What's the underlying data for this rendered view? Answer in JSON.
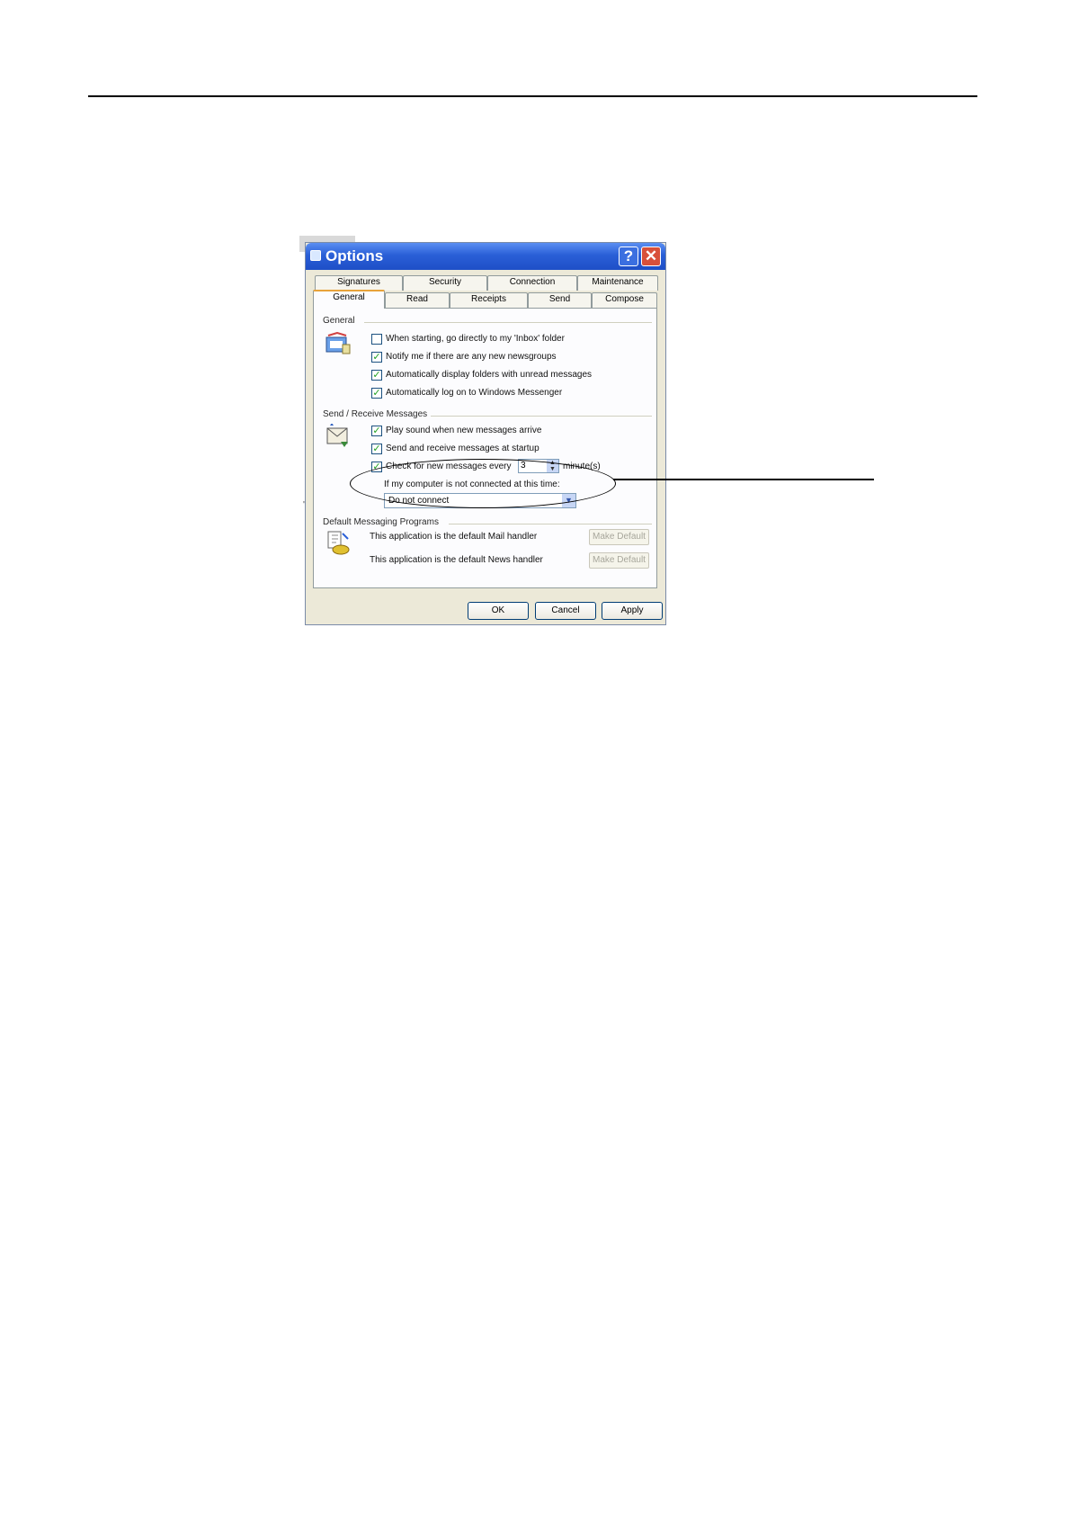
{
  "dialog": {
    "title": "Options",
    "help_label": "?",
    "close_label": "✕",
    "tabs_back": [
      "Signatures",
      "Security",
      "Connection",
      "Maintenance"
    ],
    "tabs_front": [
      "General",
      "Read",
      "Receipts",
      "Send",
      "Compose"
    ],
    "active_tab": "General"
  },
  "general": {
    "label": "General",
    "options": [
      {
        "label": "When starting, go directly to my 'Inbox' folder",
        "checked": false
      },
      {
        "label": "Notify me if there are any new newsgroups",
        "checked": true
      },
      {
        "label": "Automatically display folders with unread messages",
        "checked": true
      },
      {
        "label": "Automatically log on to Windows Messenger",
        "checked": true
      }
    ]
  },
  "send_receive": {
    "label": "Send / Receive Messages",
    "options": [
      {
        "label": "Play sound when new messages arrive",
        "checked": true
      },
      {
        "label": "Send and receive messages at startup",
        "checked": true
      },
      {
        "label": "Check for new messages every",
        "checked": true
      }
    ],
    "interval_value": "3",
    "interval_unit": "minute(s)",
    "not_connected_label": "If my computer is not connected at this time:",
    "connect_option": "Do not connect"
  },
  "default_programs": {
    "label": "Default Messaging Programs",
    "mail_text": "This application is the default Mail handler",
    "news_text": "This application is the default News handler",
    "make_default_label": "Make Default"
  },
  "buttons": {
    "ok": "OK",
    "cancel": "Cancel",
    "apply": "Apply"
  },
  "colors": {
    "titlebar": "#2a5fd7",
    "dialog_bg": "#ece9d8",
    "checkmark": "#21a121"
  }
}
